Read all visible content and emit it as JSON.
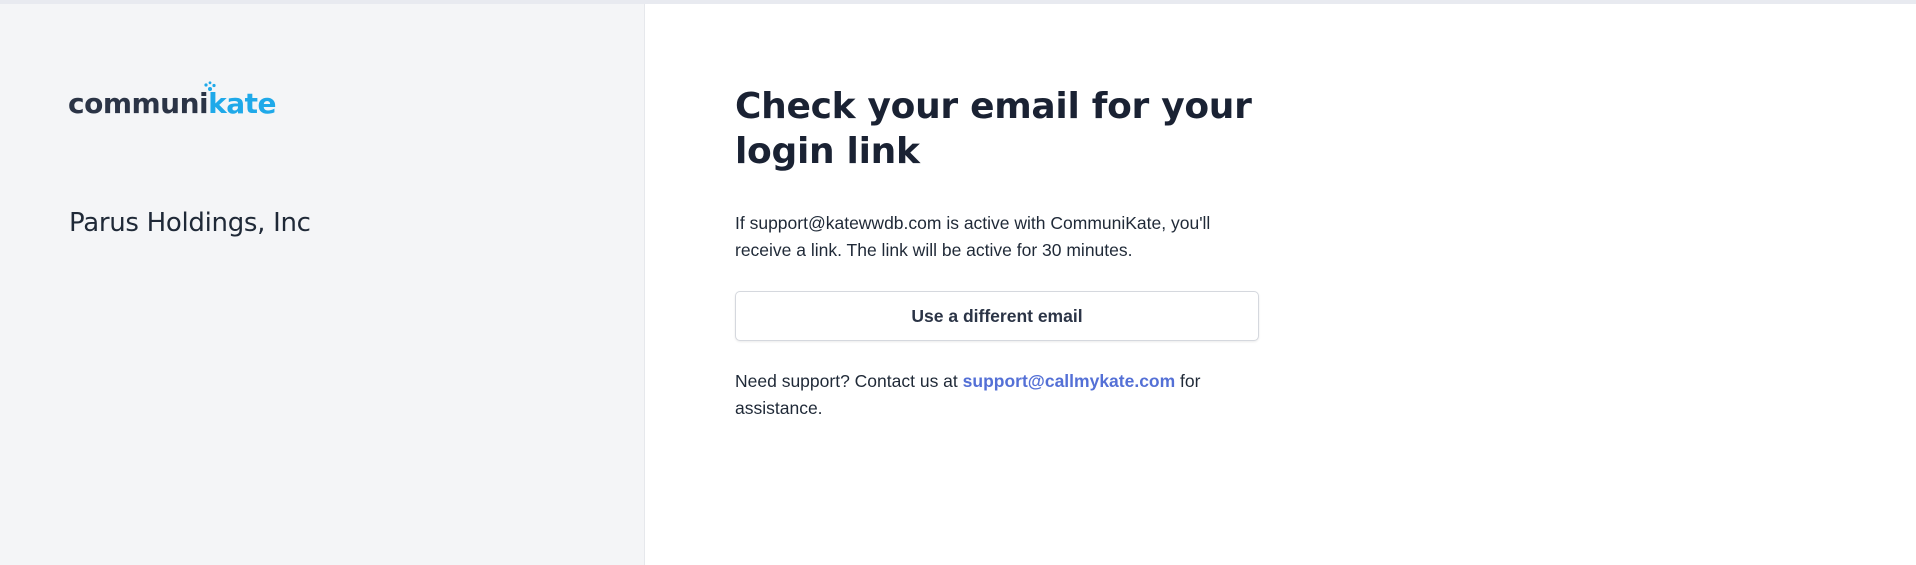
{
  "brand": {
    "logo_part1": "communi",
    "logo_part2": "kate",
    "colors": {
      "dark": "#2b3446",
      "accent": "#1fa9e9",
      "link": "#5470d6"
    }
  },
  "sidebar": {
    "org_name": "Parus Holdings, Inc"
  },
  "main": {
    "title": "Check your email for your login link",
    "message": "If support@katewwdb.com is active with CommuniKate, you'll receive a link. The link will be active for 30 minutes.",
    "button_label": "Use a different email",
    "support_prefix": "Need support? Contact us at ",
    "support_email": "support@callmykate.com",
    "support_suffix": " for assistance."
  }
}
